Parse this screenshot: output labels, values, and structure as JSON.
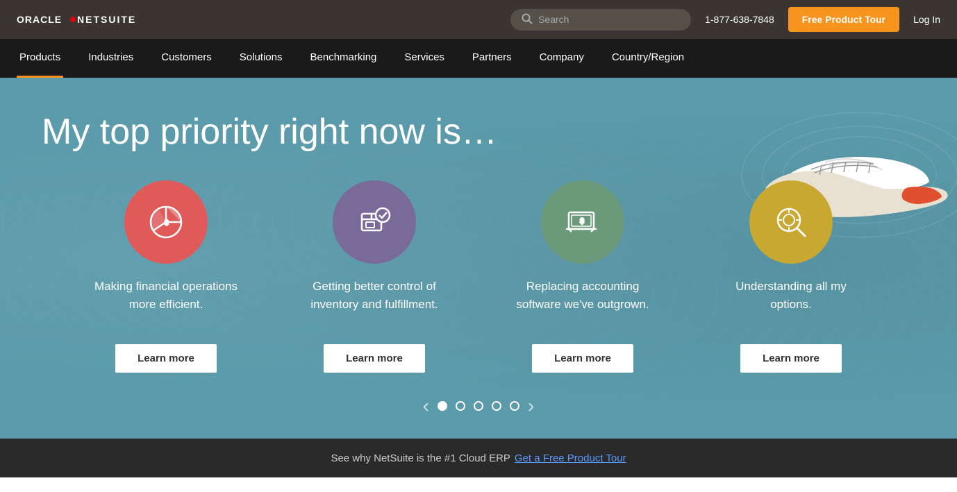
{
  "header": {
    "logo_oracle": "ORACLE",
    "logo_netsuite": "NETSUITE",
    "search_placeholder": "Search",
    "phone": "1-877-638-7848",
    "free_tour_label": "Free Product Tour",
    "login_label": "Log In"
  },
  "nav": {
    "items": [
      {
        "label": "Products",
        "active": true
      },
      {
        "label": "Industries",
        "active": false
      },
      {
        "label": "Customers",
        "active": false
      },
      {
        "label": "Solutions",
        "active": false
      },
      {
        "label": "Benchmarking",
        "active": false
      },
      {
        "label": "Services",
        "active": false
      },
      {
        "label": "Partners",
        "active": false
      },
      {
        "label": "Company",
        "active": false
      },
      {
        "label": "Country/Region",
        "active": false
      }
    ]
  },
  "hero": {
    "title": "My top priority right now is…",
    "cards": [
      {
        "icon": "pie-chart",
        "icon_color": "red",
        "text": "Making financial operations more efficient.",
        "learn_more": "Learn more"
      },
      {
        "icon": "inventory",
        "icon_color": "purple",
        "text": "Getting better control of inventory and fulfillment.",
        "learn_more": "Learn more"
      },
      {
        "icon": "laptop-dollar",
        "icon_color": "green",
        "text": "Replacing accounting software we've outgrown.",
        "learn_more": "Learn more"
      },
      {
        "icon": "search-options",
        "icon_color": "yellow",
        "text": "Understanding all my options.",
        "learn_more": "Learn more"
      }
    ],
    "carousel_dots": [
      true,
      false,
      false,
      false,
      false
    ]
  },
  "bottom_bar": {
    "text": "See why NetSuite is the #1 Cloud ERP",
    "link_text": "Get a Free Product Tour"
  }
}
